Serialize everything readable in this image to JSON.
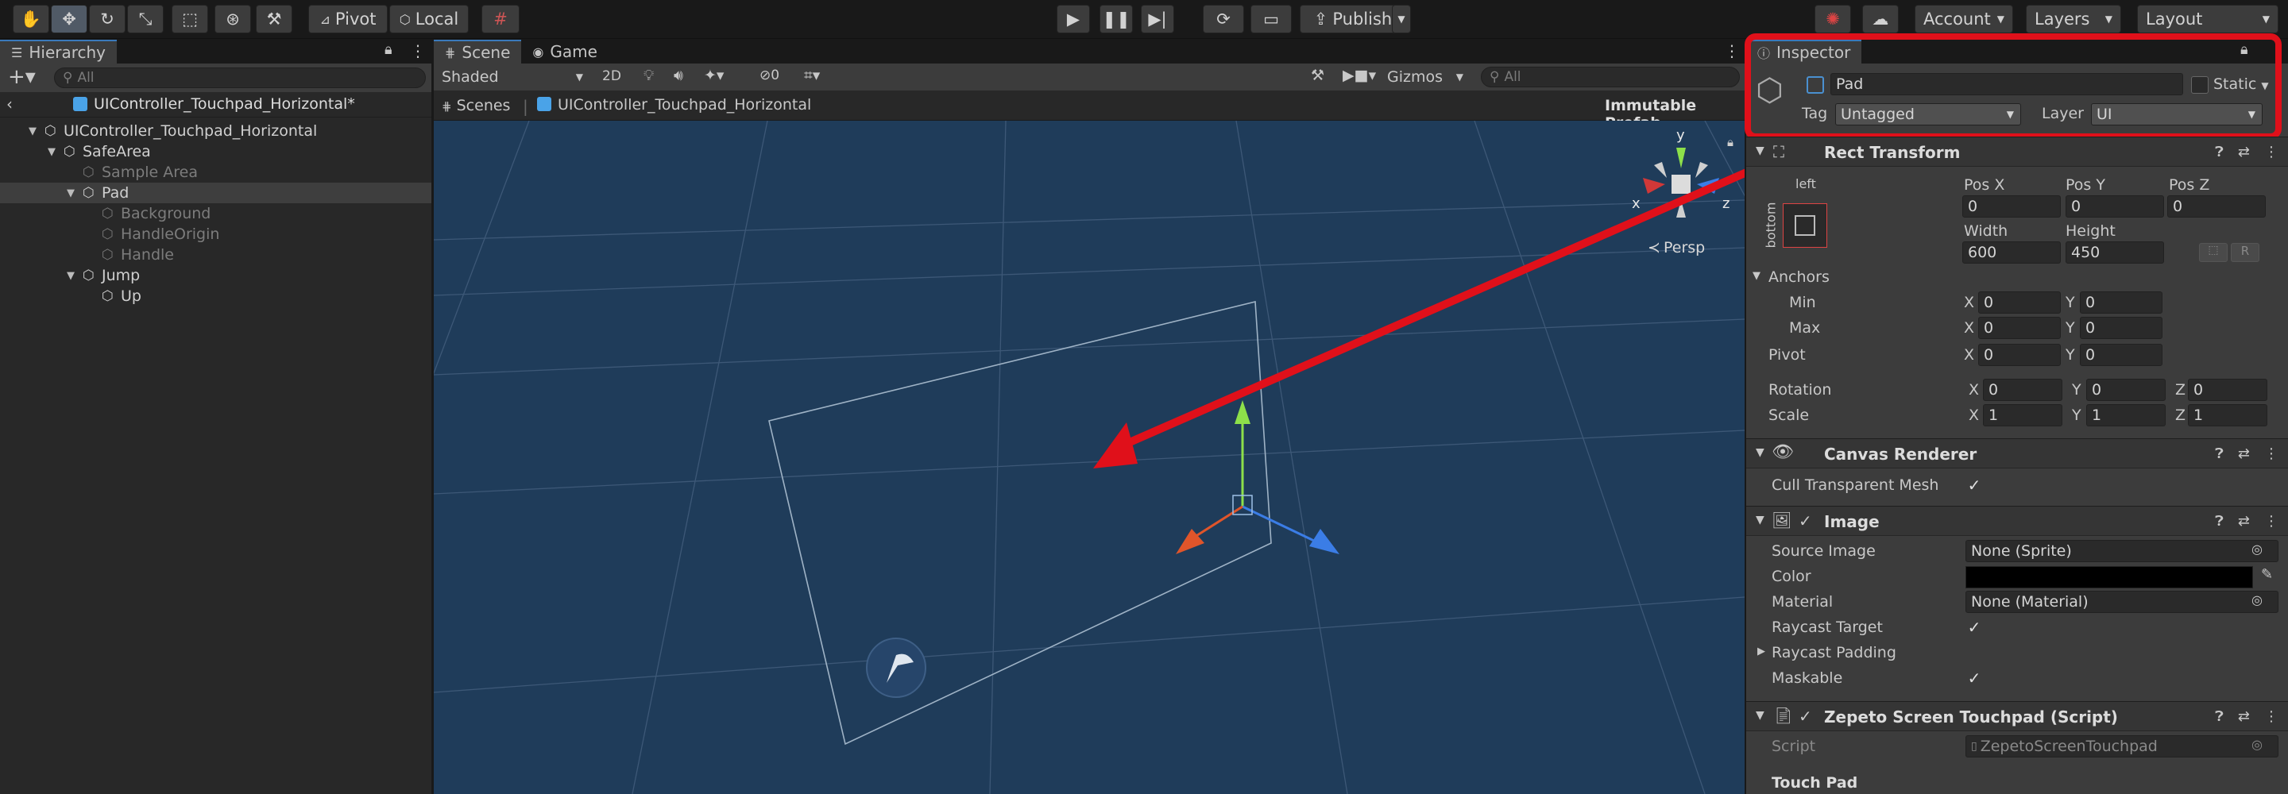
{
  "toolbar": {
    "pivot": "Pivot",
    "local": "Local",
    "publish": "Publish",
    "account": "Account",
    "layers": "Layers",
    "layout": "Layout"
  },
  "hierarchy": {
    "tab": "Hierarchy",
    "search_placeholder": "All",
    "scene_root": "UIController_Touchpad_Horizontal*",
    "items": [
      {
        "label": "UIController_Touchpad_Horizontal",
        "depth": 0,
        "fold": "open",
        "dim": false,
        "sel": false
      },
      {
        "label": "SafeArea",
        "depth": 1,
        "fold": "open",
        "dim": false,
        "sel": false
      },
      {
        "label": "Sample Area",
        "depth": 2,
        "fold": "none",
        "dim": true,
        "sel": false
      },
      {
        "label": "Pad",
        "depth": 2,
        "fold": "open",
        "dim": false,
        "sel": true
      },
      {
        "label": "Background",
        "depth": 3,
        "fold": "none",
        "dim": true,
        "sel": false
      },
      {
        "label": "HandleOrigin",
        "depth": 3,
        "fold": "none",
        "dim": true,
        "sel": false
      },
      {
        "label": "Handle",
        "depth": 3,
        "fold": "none",
        "dim": true,
        "sel": false
      },
      {
        "label": "Jump",
        "depth": 2,
        "fold": "open",
        "dim": false,
        "sel": false
      },
      {
        "label": "Up",
        "depth": 3,
        "fold": "none",
        "dim": false,
        "sel": false
      }
    ]
  },
  "scene": {
    "tab_scene": "Scene",
    "tab_game": "Game",
    "shading": "Shaded",
    "mode_2d": "2D",
    "hidden_count": "0",
    "gizmos": "Gizmos",
    "search_placeholder": "All",
    "breadcrumb_scenes": "Scenes",
    "breadcrumb_prefab": "UIController_Touchpad_Horizontal",
    "immutable": "Immutable Prefab",
    "persp": "Persp",
    "axis_y": "y",
    "axis_x": "x",
    "axis_z": "z"
  },
  "inspector": {
    "tab": "Inspector",
    "object_name": "Pad",
    "static_label": "Static",
    "tag_label": "Tag",
    "tag_value": "Untagged",
    "layer_label": "Layer",
    "layer_value": "UI",
    "rect": {
      "title": "Rect Transform",
      "anchor_top": "left",
      "anchor_side": "bottom",
      "pos_x_label": "Pos X",
      "pos_y_label": "Pos Y",
      "pos_z_label": "Pos Z",
      "pos_x": "0",
      "pos_y": "0",
      "pos_z": "0",
      "width_label": "Width",
      "height_label": "Height",
      "width": "600",
      "height": "450",
      "r_btn": "R",
      "anchors": "Anchors",
      "min": "Min",
      "max": "Max",
      "pivot": "Pivot",
      "rotation": "Rotation",
      "scale": "Scale",
      "x": "X",
      "y": "Y",
      "z": "Z",
      "min_x": "0",
      "min_y": "0",
      "max_x": "0",
      "max_y": "0",
      "pivot_x": "0",
      "pivot_y": "0",
      "rot_x": "0",
      "rot_y": "0",
      "rot_z": "0",
      "scale_x": "1",
      "scale_y": "1",
      "scale_z": "1"
    },
    "canvas_renderer": {
      "title": "Canvas Renderer",
      "cull": "Cull Transparent Mesh"
    },
    "image": {
      "title": "Image",
      "source_label": "Source Image",
      "source_value": "None (Sprite)",
      "color_label": "Color",
      "material_label": "Material",
      "material_value": "None (Material)",
      "raycast_target": "Raycast Target",
      "raycast_padding": "Raycast Padding",
      "maskable": "Maskable"
    },
    "script": {
      "title": "Zepeto Screen Touchpad (Script)",
      "script_label": "Script",
      "script_value": "ZepetoScreenTouchpad",
      "touch_pad": "Touch Pad"
    }
  },
  "colors": {
    "accent": "#3a79bb",
    "highlight_red": "#e0101a",
    "selected_row": "#3e3e3e"
  }
}
